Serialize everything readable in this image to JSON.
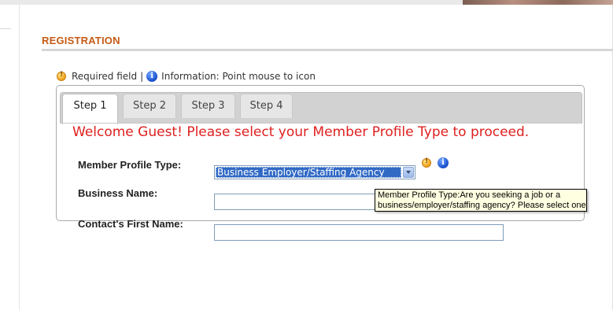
{
  "section": {
    "title": "REGISTRATION"
  },
  "legend": {
    "required_text": "Required field",
    "separator": "|",
    "info_text": "Information: Point mouse to icon",
    "required_icon": "exclamation-circle-icon",
    "info_icon": "info-circle-icon"
  },
  "tabs": [
    {
      "label": "Step 1",
      "active": true
    },
    {
      "label": "Step 2",
      "active": false
    },
    {
      "label": "Step 3",
      "active": false
    },
    {
      "label": "Step 4",
      "active": false
    }
  ],
  "welcome_message": "Welcome Guest! Please select your Member Profile Type to proceed.",
  "form": {
    "member_profile_type": {
      "label": "Member Profile Type:",
      "selected": "Business Employer/Staffing Agency"
    },
    "business_name": {
      "label": "Business Name:",
      "value": ""
    },
    "contact_first_name": {
      "label": "Contact's First Name:",
      "value": ""
    }
  },
  "tooltip": {
    "line1": "Member Profile Type:Are you seeking a job or a",
    "line2": "business/employer/staffing agency? Please select one."
  },
  "colors": {
    "section_title": "#c65a15",
    "welcome_text": "#e02020",
    "select_highlight": "#316ac5",
    "tooltip_bg": "#ffffe1"
  }
}
